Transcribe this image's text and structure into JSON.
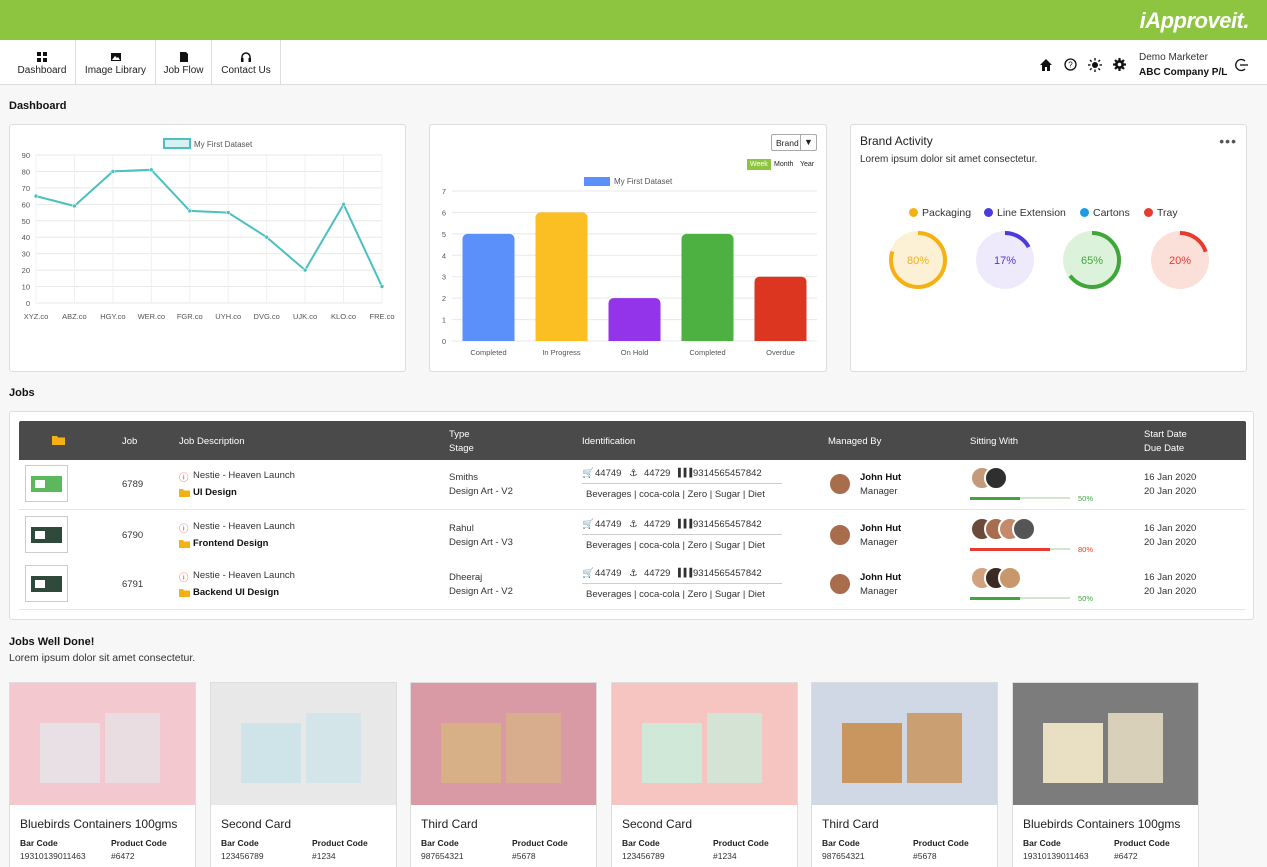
{
  "app": {
    "logo": "iApproveit.",
    "nav": [
      {
        "label": "Dashboard",
        "icon": "grid-icon"
      },
      {
        "label": "Image Library",
        "icon": "image-icon"
      },
      {
        "label": "Job Flow",
        "icon": "document-icon"
      },
      {
        "label": "Contact Us",
        "icon": "headset-icon"
      }
    ],
    "header_icons": [
      "home-icon",
      "help-icon",
      "sun-icon",
      "gear-icon",
      "logout-icon"
    ],
    "user": {
      "name": "Demo Marketer",
      "company": "ABC Company P/L"
    },
    "accent_color": "#8dc540"
  },
  "dashboard": {
    "title": "Dashboard"
  },
  "chart_data": [
    {
      "type": "line",
      "series": [
        {
          "name": "My First Dataset",
          "values": [
            65,
            59,
            80,
            81,
            56,
            55,
            40,
            20,
            60,
            10
          ]
        }
      ],
      "categories": [
        "XYZ.co",
        "ABZ.co",
        "HGY.co",
        "WER.co",
        "FGR.co",
        "UYH.co",
        "DVG.co",
        "UJK.co",
        "KLO.co",
        "FRE.co"
      ],
      "ylim": [
        0,
        90
      ],
      "yticks": [
        0,
        10,
        20,
        30,
        40,
        50,
        60,
        70,
        80,
        90
      ],
      "color": "#4bc0c0",
      "grid": true,
      "legend": "top"
    },
    {
      "type": "bar",
      "series": [
        {
          "name": "My First Dataset",
          "values": [
            5,
            6,
            2,
            5,
            3
          ]
        }
      ],
      "categories": [
        "Completed",
        "In Progress",
        "On Hold",
        "Completed",
        "Overdue"
      ],
      "colors": [
        "#5b8ff9",
        "#fbbf24",
        "#9333ea",
        "#4cb140",
        "#dc3520"
      ],
      "ylim": [
        0,
        7
      ],
      "yticks": [
        0,
        1,
        2,
        3,
        4,
        5,
        6,
        7
      ],
      "grid": true,
      "legend": "top",
      "filter": {
        "label": "Brand",
        "periods": [
          "Week",
          "Month",
          "Year"
        ],
        "active": "Week"
      }
    }
  ],
  "brand_activity": {
    "title": "Brand Activity",
    "subtitle": "Lorem ipsum dolor sit amet consectetur.",
    "items": [
      {
        "name": "Packaging",
        "percent": 80,
        "label": "80%",
        "color": "#f5b014",
        "bg": "#fdf1d5"
      },
      {
        "name": "Line Extension",
        "percent": 17,
        "label": "17%",
        "color": "#4b3bdc",
        "bg": "#eeeafc"
      },
      {
        "name": "Cartons",
        "percent": 65,
        "label": "65%",
        "color": "#3fa73a",
        "bg": "#ddf2db"
      },
      {
        "name": "Tray",
        "percent": 20,
        "label": "20%",
        "color": "#e63b2e",
        "bg": "#fbe0da"
      }
    ]
  },
  "jobs": {
    "title": "Jobs",
    "headers": {
      "job": "Job",
      "description": "Job Description",
      "type": "Type",
      "stage": "Stage",
      "identification": "Identification",
      "managed_by": "Managed By",
      "sitting_with": "Sitting With",
      "start_date": "Start Date",
      "due_date": "Due Date"
    },
    "rows": [
      {
        "job": "6789",
        "client": "Nestie - Heaven Launch",
        "task": "UI Design",
        "type": "Smiths",
        "stage": "Design Art - V2",
        "cart": "44749",
        "anchor": "44729",
        "barcode": "9314565457842",
        "tags": "Beverages | coca-cola | Zero | Sugar | Diet",
        "manager": "John Hut",
        "role": "Manager",
        "progress": 50,
        "progress_label": "50%",
        "progress_color": "#3fa73a",
        "start": "16 Jan 2020",
        "due": "20 Jan 2020"
      },
      {
        "job": "6790",
        "client": "Nestie - Heaven Launch",
        "task": "Frontend Design",
        "type": "Rahul",
        "stage": "Design Art - V3",
        "cart": "44749",
        "anchor": "44729",
        "barcode": "9314565457842",
        "tags": "Beverages | coca-cola | Zero | Sugar | Diet",
        "manager": "John Hut",
        "role": "Manager",
        "progress": 80,
        "progress_label": "80%",
        "progress_color": "#e63b2e",
        "start": "16 Jan 2020",
        "due": "20 Jan 2020"
      },
      {
        "job": "6791",
        "client": "Nestie - Heaven Launch",
        "task": "Backend UI Design",
        "type": "Dheeraj",
        "stage": "Design Art - V2",
        "cart": "44749",
        "anchor": "44729",
        "barcode": "9314565457842",
        "tags": "Beverages | coca-cola | Zero | Sugar | Diet",
        "manager": "John Hut",
        "role": "Manager",
        "progress": 50,
        "progress_label": "50%",
        "progress_color": "#3fa73a",
        "start": "16 Jan 2020",
        "due": "20 Jan 2020"
      }
    ]
  },
  "well_done": {
    "title": "Jobs Well Done!",
    "subtitle": "Lorem ipsum dolor sit amet consectetur.",
    "bar_code_label": "Bar Code",
    "product_code_label": "Product Code",
    "cards": [
      {
        "name": "Bluebirds Containers 100gms",
        "bar_code": "19310139011463",
        "product_code": "#6472"
      },
      {
        "name": "Second Card",
        "bar_code": "123456789",
        "product_code": "#1234"
      },
      {
        "name": "Third Card",
        "bar_code": "987654321",
        "product_code": "#5678"
      },
      {
        "name": "Second Card",
        "bar_code": "123456789",
        "product_code": "#1234"
      },
      {
        "name": "Third Card",
        "bar_code": "987654321",
        "product_code": "#5678"
      },
      {
        "name": "Bluebirds Containers 100gms",
        "bar_code": "19310139011463",
        "product_code": "#6472"
      }
    ]
  }
}
